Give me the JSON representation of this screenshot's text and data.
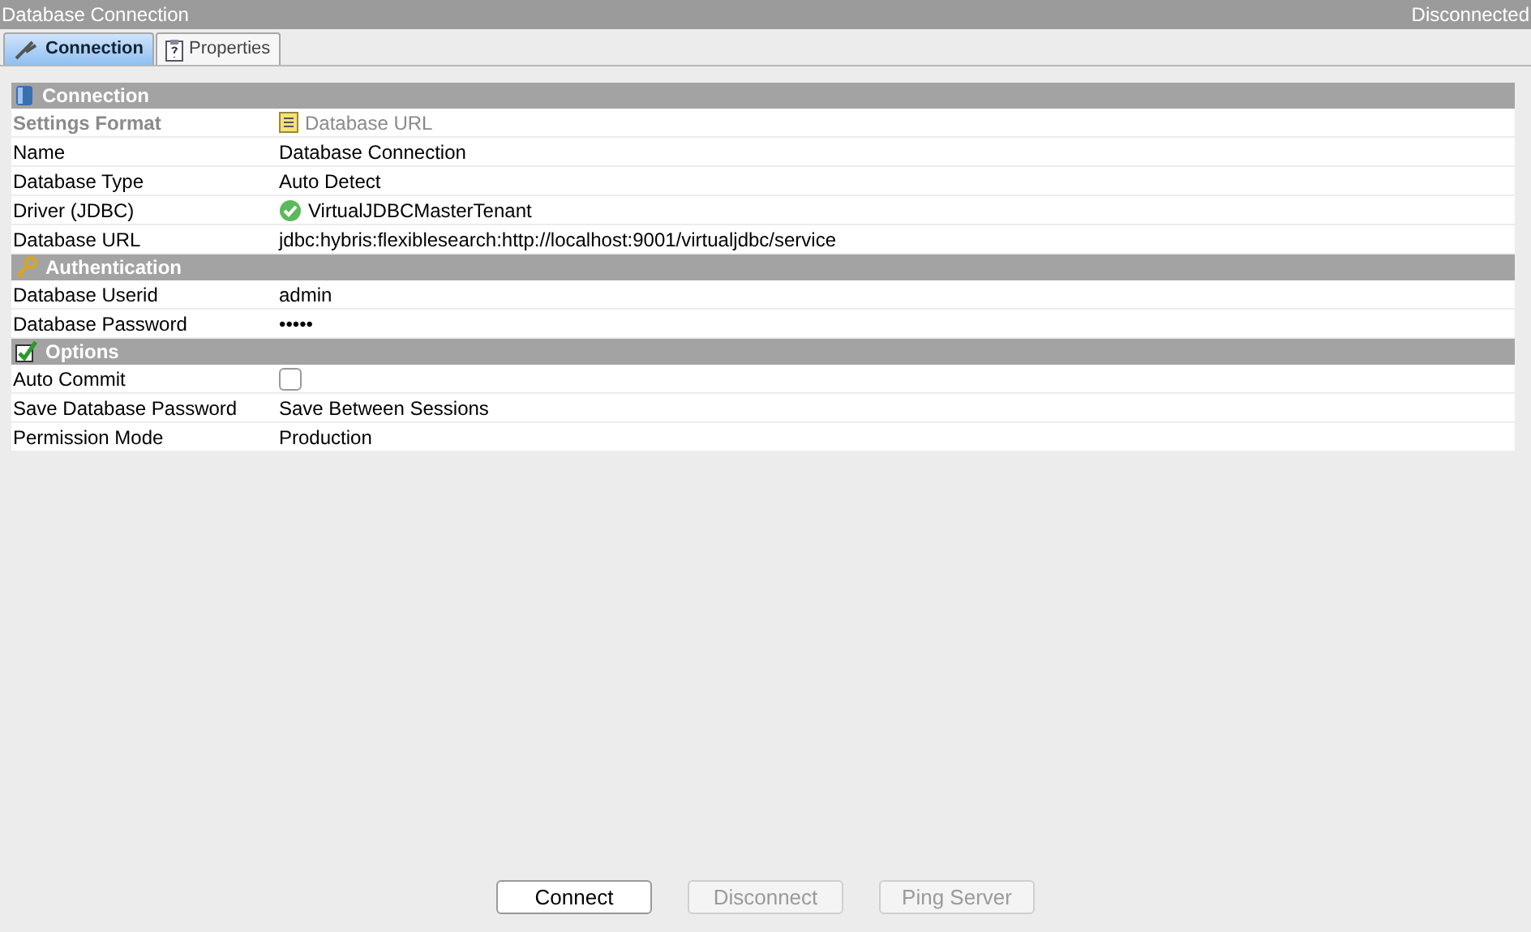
{
  "window": {
    "title": "Database Connection",
    "status": "Disconnected"
  },
  "tabs": [
    {
      "label": "Connection",
      "selected": true
    },
    {
      "label": "Properties",
      "selected": false
    }
  ],
  "sections": [
    {
      "title": "Connection",
      "rows": [
        {
          "label": "Settings Format",
          "value": "Database URL",
          "kind": "disabled"
        },
        {
          "label": "Name",
          "value": "Database Connection",
          "kind": "text"
        },
        {
          "label": "Database Type",
          "value": "Auto Detect",
          "kind": "text"
        },
        {
          "label": "Driver (JDBC)",
          "value": "VirtualJDBCMasterTenant",
          "kind": "status"
        },
        {
          "label": "Database URL",
          "value": "jdbc:hybris:flexiblesearch:http://localhost:9001/virtualjdbc/service",
          "kind": "text"
        }
      ]
    },
    {
      "title": "Authentication",
      "rows": [
        {
          "label": "Database Userid",
          "value": "admin",
          "kind": "text"
        },
        {
          "label": "Database Password",
          "value": "•••••",
          "kind": "text"
        }
      ]
    },
    {
      "title": "Options",
      "rows": [
        {
          "label": "Auto Commit",
          "kind": "checkbox",
          "checked": false
        },
        {
          "label": "Save Database Password",
          "value": "Save Between Sessions",
          "kind": "text"
        },
        {
          "label": "Permission Mode",
          "value": "Production",
          "kind": "text"
        }
      ]
    }
  ],
  "buttons": [
    {
      "label": "Connect",
      "disabled": false
    },
    {
      "label": "Disconnect",
      "disabled": true
    },
    {
      "label": "Ping Server",
      "disabled": true
    }
  ]
}
